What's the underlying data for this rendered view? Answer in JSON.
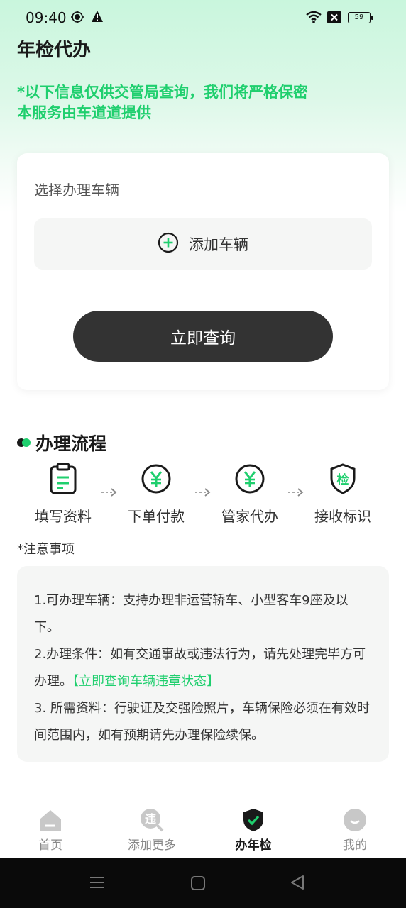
{
  "status_bar": {
    "time": "09:40",
    "battery": "59"
  },
  "page": {
    "title": "年检代办"
  },
  "notice": {
    "line1": "*以下信息仅供交管局查询，我们将严格保密",
    "line2": "本服务由车道道提供"
  },
  "vehicle_card": {
    "label": "选择办理车辆",
    "add_vehicle": "添加车辆",
    "query_button": "立即查询"
  },
  "process": {
    "heading": "办理流程",
    "steps": [
      {
        "label": "填写资料",
        "icon": "clipboard-icon"
      },
      {
        "label": "下单付款",
        "icon": "yuan-icon"
      },
      {
        "label": "管家代办",
        "icon": "yuan-icon"
      },
      {
        "label": "接收标识",
        "icon": "inspection-shield-icon",
        "icon_text": "检"
      }
    ]
  },
  "notes": {
    "heading": "*注意事项",
    "item1": "1.可办理车辆：支持办理非运营轿车、小型客车9座及以下。",
    "item2": "2.办理条件：如有交通事故或违法行为，请先处理完毕方可办理。",
    "item2_link": "【立即查询车辆违章状态】",
    "item3": "3. 所需资料：行驶证及交强险照片，车辆保险必须在有效时间范围内，如有预期请先办理保险续保。"
  },
  "bottom_nav": [
    {
      "label": "首页",
      "icon": "home-icon"
    },
    {
      "label": "添加更多",
      "icon": "violation-icon",
      "icon_text": "违"
    },
    {
      "label": "办年检",
      "icon": "shield-check-icon",
      "active": true
    },
    {
      "label": "我的",
      "icon": "profile-icon"
    }
  ],
  "colors": {
    "accent": "#1fcf6e",
    "dark_button": "#333333",
    "card_bg": "#f5f6f5"
  }
}
